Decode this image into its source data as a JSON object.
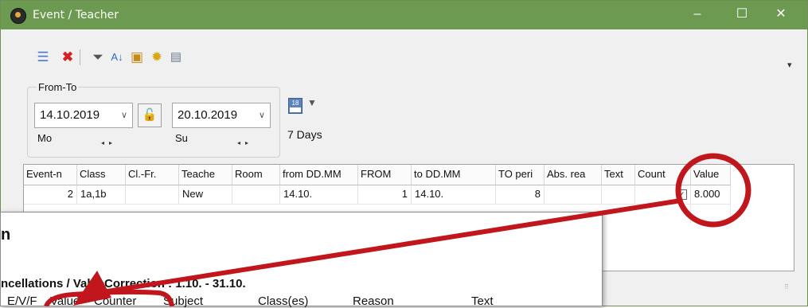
{
  "window": {
    "title": "Event / Teacher"
  },
  "controls": {
    "minimize": "–",
    "maximize": "☐",
    "close": "✕"
  },
  "filter": {
    "group_label": "From-To",
    "from_date": "14.10.2019",
    "from_day": "Mo",
    "to_date": "20.10.2019",
    "to_day": "Su",
    "range_label": "7 Days",
    "calendar_icon_text": "18"
  },
  "grid": {
    "columns": [
      "Event-n",
      "Class",
      "Cl.-Fr.",
      "Teache",
      "Room",
      "from DD.MM",
      "FROM",
      "to DD.MM",
      "TO peri",
      "Abs. rea",
      "Text",
      "Count",
      "Value"
    ],
    "rows": [
      {
        "event_no": "2",
        "class": "1a,1b",
        "cl_fr": "",
        "teacher": "New",
        "room": "",
        "from_dd_mm": "14.10.",
        "from": "1",
        "to_dd_mm": "14.10.",
        "to_period": "8",
        "abs_reason": "",
        "text": "",
        "count_checked": true,
        "value": "8.000"
      }
    ]
  },
  "report_panel": {
    "heading": "n",
    "report_line": "ncellations / ValueCorrection : 1.10. - 31.10.",
    "columns": [
      "E/V/F",
      "Value",
      "Counter",
      "Subject",
      "Class(es)",
      "Reason",
      "Text"
    ]
  },
  "colors": {
    "titlebar": "#6c9a51",
    "annotation": "#c0161c"
  }
}
